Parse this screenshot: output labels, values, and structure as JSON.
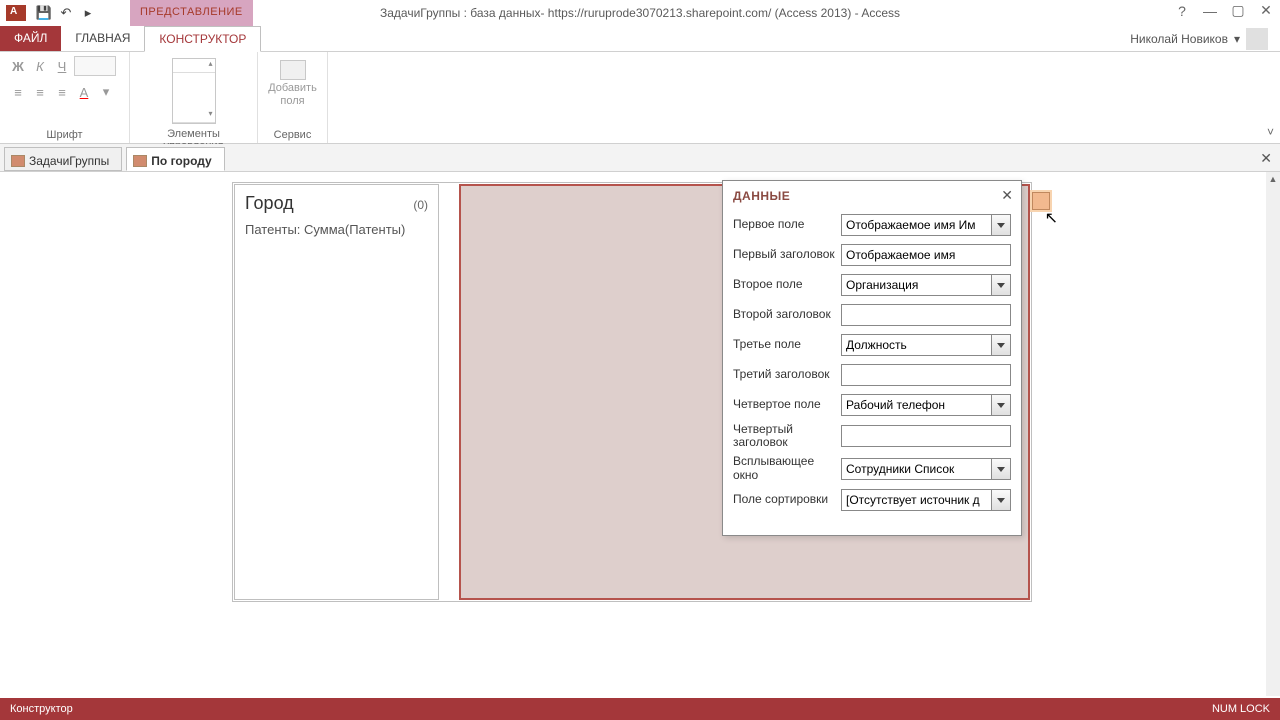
{
  "titlebar": {
    "context_tab": "ПРЕДСТАВЛЕНИЕ",
    "title": "ЗадачиГруппы : база данных- https://ruruprode3070213.sharepoint.com/ (Access 2013) - Access",
    "help": "?"
  },
  "tabs": {
    "file": "ФАЙЛ",
    "home": "ГЛАВНАЯ",
    "design": "КОНСТРУКТОР"
  },
  "user": {
    "name": "Николай Новиков"
  },
  "ribbon": {
    "font_group": "Шрифт",
    "controls_group": "Элементы управления",
    "add_fields_btn_l1": "Добавить",
    "add_fields_btn_l2": "поля",
    "service_group": "Сервис",
    "bold": "Ж",
    "italic": "К",
    "underline": "Ч",
    "font_color": "A"
  },
  "doctabs": {
    "t1": "ЗадачиГруппы",
    "t2": "По городу"
  },
  "left_panel": {
    "header": "Город",
    "count": "(0)",
    "sub": "Патенты: Сумма(Патенты)"
  },
  "popup": {
    "title": "ДАННЫЕ",
    "rows": {
      "f1_label": "Первое поле",
      "f1_value": "Отображаемое имя Им",
      "h1_label": "Первый заголовок",
      "h1_value": "Отображаемое имя",
      "f2_label": "Второе поле",
      "f2_value": "Организация",
      "h2_label": "Второй заголовок",
      "h2_value": "",
      "f3_label": "Третье поле",
      "f3_value": "Должность",
      "h3_label": "Третий заголовок",
      "h3_value": "",
      "f4_label": "Четвертое поле",
      "f4_value": "Рабочий телефон",
      "h4_label": "Четвертый заголовок",
      "h4_value": "",
      "pw_label": "Всплывающее окно",
      "pw_value": "Сотрудники Список",
      "sort_label": "Поле сортировки",
      "sort_value": "[Отсутствует источник д"
    }
  },
  "status": {
    "left": "Конструктор",
    "right": "NUM LOCK"
  }
}
